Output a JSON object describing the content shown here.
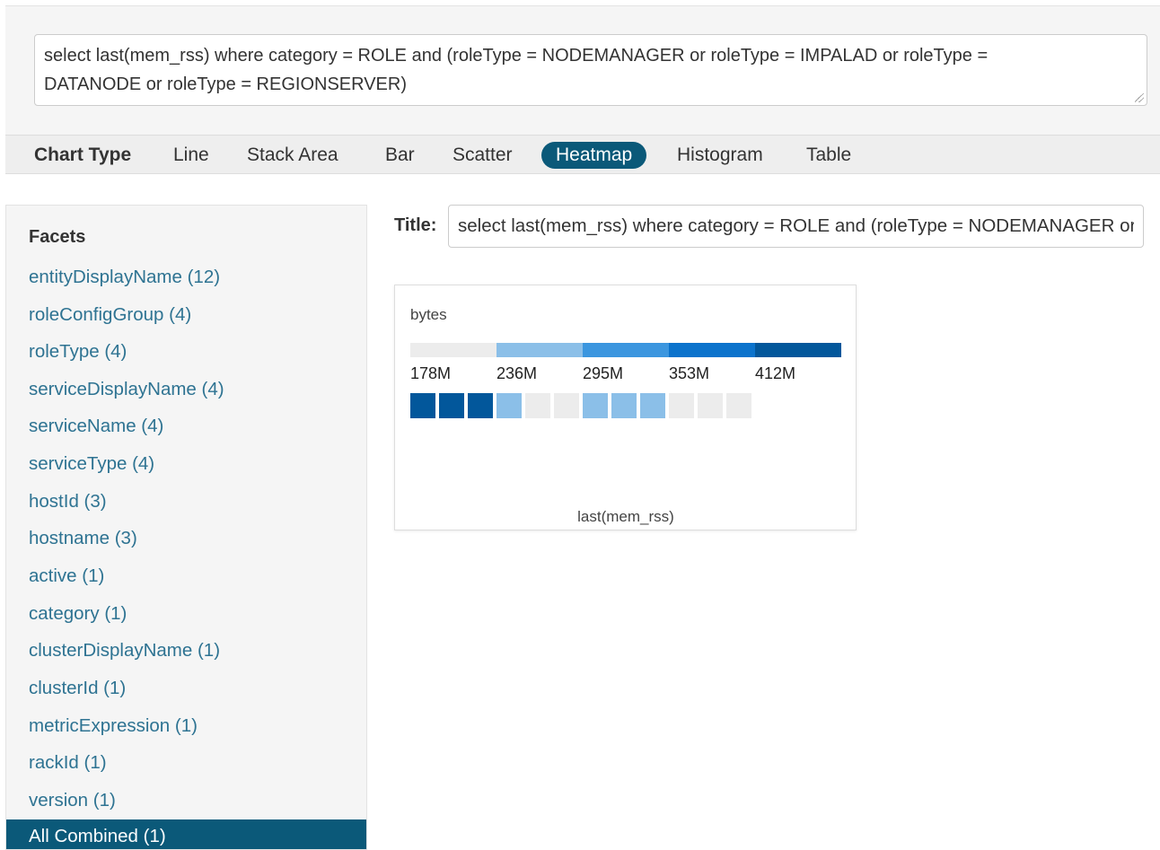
{
  "query": {
    "line1": "select last(mem_rss) where category = ROLE and (roleType = NODEMANAGER or roleType = IMPALAD or roleType =",
    "line2": "DATANODE or roleType = REGIONSERVER)"
  },
  "toolbar": {
    "label": "Chart Type",
    "items": [
      "Line",
      "Stack Area",
      "Bar",
      "Scatter",
      "Heatmap",
      "Histogram",
      "Table"
    ],
    "active": "Heatmap"
  },
  "facets": {
    "title": "Facets",
    "items": [
      "entityDisplayName (12)",
      "roleConfigGroup (4)",
      "roleType (4)",
      "serviceDisplayName (4)",
      "serviceName (4)",
      "serviceType (4)",
      "hostId (3)",
      "hostname (3)",
      "active (1)",
      "category (1)",
      "clusterDisplayName (1)",
      "clusterId (1)",
      "metricExpression (1)",
      "rackId (1)",
      "version (1)"
    ],
    "selected": "All Combined (1)"
  },
  "title": {
    "label": "Title:",
    "value": "select last(mem_rss) where category = ROLE and (roleType = NODEMANAGER or roleType = IMPALAD or roleType = DATANODE or roleType = REGIONSERVER)"
  },
  "chart_data": {
    "type": "heatmap",
    "unit_label": "bytes",
    "xlabel": "last(mem_rss)",
    "legend": {
      "ticks": [
        "178M",
        "236M",
        "295M",
        "353M",
        "412M"
      ],
      "colors": [
        "#ececec",
        "#8bbfe8",
        "#3b96df",
        "#0b73cc",
        "#02579b"
      ]
    },
    "cell_bins": [
      4,
      4,
      4,
      1,
      0,
      0,
      1,
      1,
      1,
      0,
      0,
      0
    ]
  }
}
